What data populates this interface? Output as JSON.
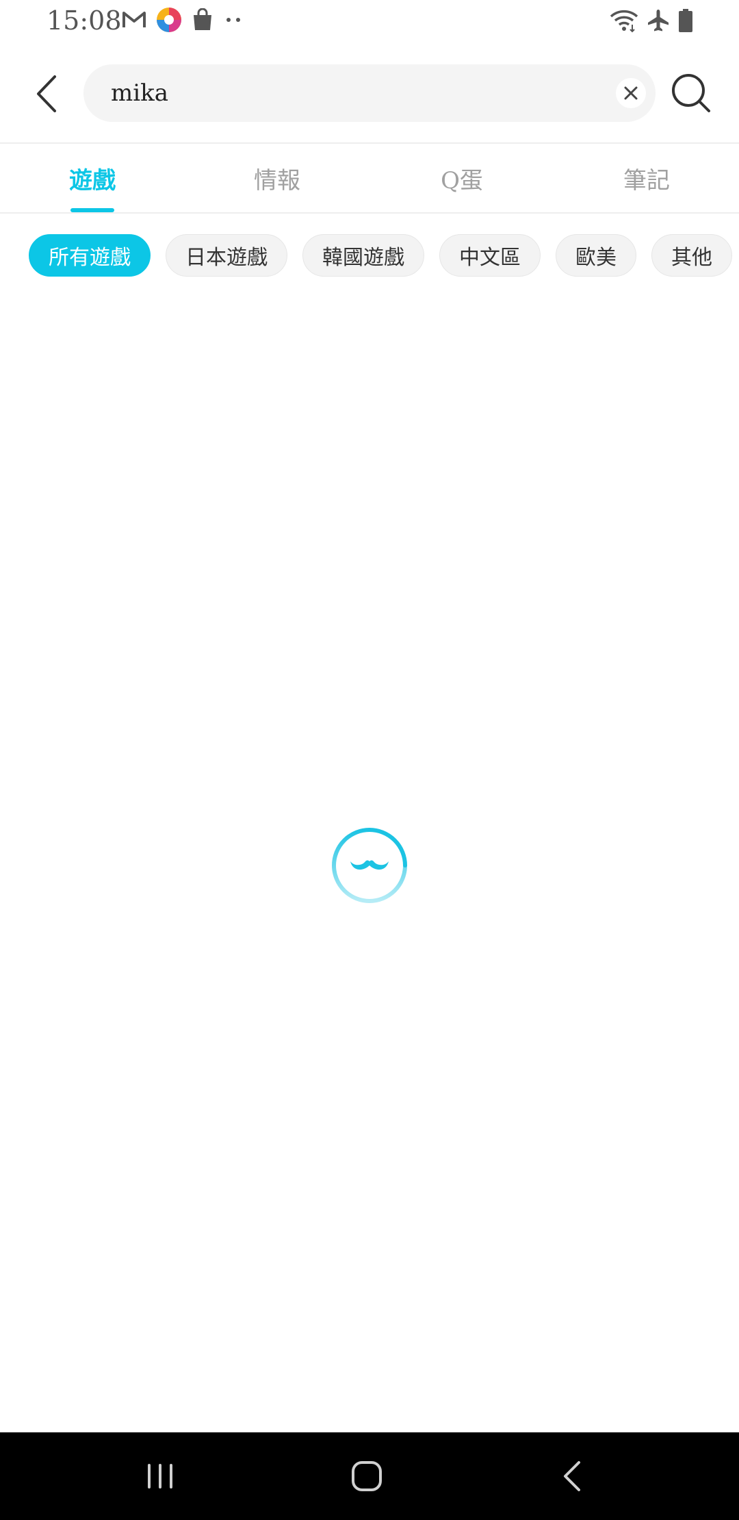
{
  "status_bar": {
    "time": "15:08",
    "left_icons": [
      "gmail-icon",
      "colorful-app-icon",
      "shopping-bag-icon",
      "more-dots-icon"
    ],
    "right_icons": [
      "wifi-icon",
      "airplane-icon",
      "battery-icon"
    ]
  },
  "search": {
    "query": "mika"
  },
  "tabs": [
    {
      "label": "遊戲",
      "active": true
    },
    {
      "label": "情報",
      "active": false
    },
    {
      "label": "Q蛋",
      "active": false
    },
    {
      "label": "筆記",
      "active": false
    }
  ],
  "chips": [
    {
      "label": "所有遊戲",
      "active": true
    },
    {
      "label": "日本遊戲",
      "active": false
    },
    {
      "label": "韓國遊戲",
      "active": false
    },
    {
      "label": "中文區",
      "active": false
    },
    {
      "label": "歐美",
      "active": false
    },
    {
      "label": "其他",
      "active": false
    }
  ],
  "colors": {
    "accent": "#0cc6e6",
    "nav_bar": "#000000",
    "chip_bg": "#f3f3f3"
  },
  "loading": {
    "icon": "mustache-loading-spinner-icon"
  },
  "nav": {
    "icons": [
      "recent-apps-icon",
      "home-icon",
      "back-nav-icon"
    ]
  }
}
